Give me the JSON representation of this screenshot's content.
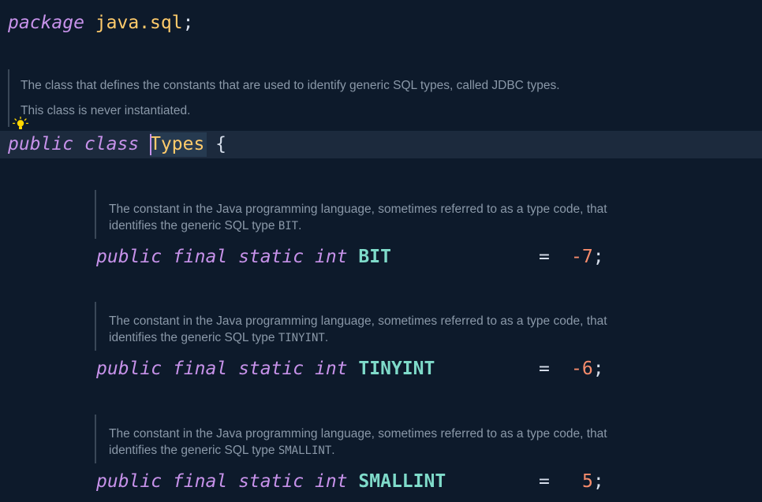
{
  "package_line": {
    "keyword": "package",
    "name": "java.sql",
    "semicolon": ";"
  },
  "class_doc": {
    "line1": "The class that defines the constants that are used to identify generic SQL types, called JDBC types.",
    "line2": "This class is never instantiated."
  },
  "class_line": {
    "mod1": "public",
    "mod2": "class",
    "name": "Types",
    "brace": "{"
  },
  "fields": [
    {
      "doc_line1": "The constant in the Java programming language, sometimes referred to as a type code, that",
      "doc_prefix": "identifies the generic SQL type ",
      "doc_code": "BIT",
      "doc_suffix": ".",
      "m1": "public",
      "m2": "final",
      "m3": "static",
      "type": "int",
      "name": "BIT",
      "eq": "=",
      "value": "-7",
      "semi": ";"
    },
    {
      "doc_line1": "The constant in the Java programming language, sometimes referred to as a type code, that",
      "doc_prefix": "identifies the generic SQL type ",
      "doc_code": "TINYINT",
      "doc_suffix": ".",
      "m1": "public",
      "m2": "final",
      "m3": "static",
      "type": "int",
      "name": "TINYINT",
      "eq": "=",
      "value": "-6",
      "semi": ";"
    },
    {
      "doc_line1": "The constant in the Java programming language, sometimes referred to as a type code, that",
      "doc_prefix": "identifies the generic SQL type ",
      "doc_code": "SMALLINT",
      "doc_suffix": ".",
      "m1": "public",
      "m2": "final",
      "m3": "static",
      "type": "int",
      "name": "SMALLINT",
      "eq": "=",
      "value": "5",
      "semi": ";"
    }
  ],
  "colors": {
    "background": "#0d1a2b",
    "keyword": "#c792ea",
    "type_name": "#ffcb6b",
    "constant": "#7fdbca",
    "number": "#f78c6c",
    "doc_text": "#8a98a8",
    "current_line": "#1c2a3d"
  },
  "icons": {
    "gutter": "lightbulb-icon"
  }
}
